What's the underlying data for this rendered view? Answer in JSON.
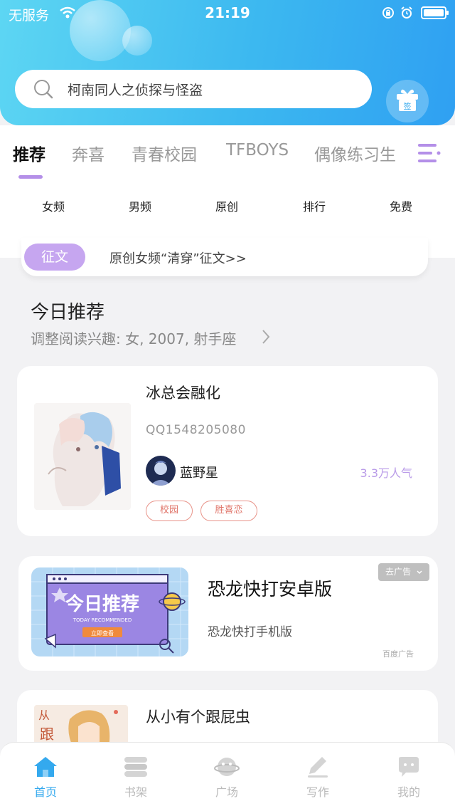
{
  "status_bar": {
    "carrier": "无服务",
    "time": "21:19"
  },
  "search": {
    "placeholder": "柯南同人之侦探与怪盗"
  },
  "gift": {
    "label": "签"
  },
  "tabs": [
    "推荐",
    "奔喜",
    "青春校园",
    "TFBOYS",
    "偶像练习生"
  ],
  "active_tab": "推荐",
  "categories": [
    "女频",
    "男频",
    "原创",
    "排行",
    "免费"
  ],
  "notice": {
    "badge": "征文",
    "text": "原创女频“清穿”征文>>"
  },
  "section": {
    "title": "今日推荐",
    "subtitle": "调整阅读兴趣: 女, 2007, 射手座"
  },
  "books": [
    {
      "title": "冰总会融化",
      "author_id": "QQ1548205080",
      "author": "蓝野星",
      "popularity": "3.3万人气",
      "tags": [
        "校园",
        "胜喜恋"
      ]
    },
    {
      "title": "从小有个跟屁虫"
    }
  ],
  "ad": {
    "close_label": "去广告",
    "title": "恐龙快打安卓版",
    "description": "恐龙快打手机版",
    "source": "百度广告",
    "banner_text": "今日推荐",
    "banner_subtext": "TODAY RECOMMENDED",
    "banner_button": "立即查看"
  },
  "bottom_nav": [
    {
      "label": "首页",
      "icon": "home-icon",
      "active": true
    },
    {
      "label": "书架",
      "icon": "bookshelf-icon",
      "active": false
    },
    {
      "label": "广场",
      "icon": "planet-icon",
      "active": false
    },
    {
      "label": "写作",
      "icon": "pen-icon",
      "active": false
    },
    {
      "label": "我的",
      "icon": "chat-bubble-icon",
      "active": false
    }
  ],
  "colors": {
    "accent_blue": "#34a9ee",
    "accent_purple": "#b48fe8",
    "tag_red": "#e0756a"
  }
}
